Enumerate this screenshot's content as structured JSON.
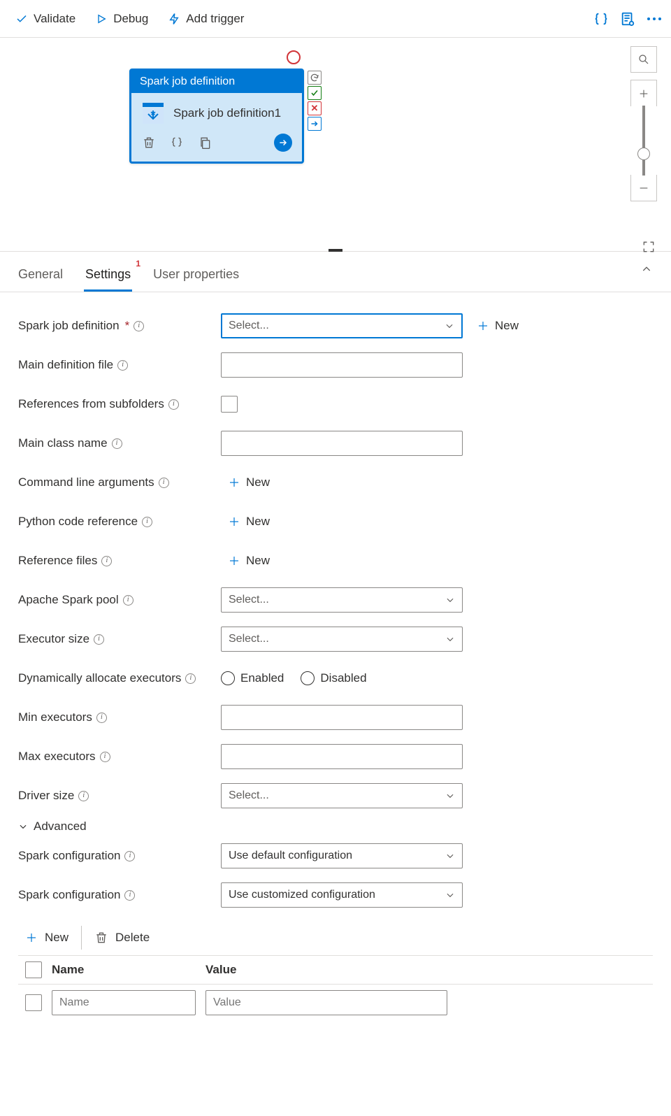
{
  "toolbar": {
    "validate": "Validate",
    "debug": "Debug",
    "add_trigger": "Add trigger"
  },
  "activity": {
    "header": "Spark job definition",
    "title": "Spark job definition1"
  },
  "tabs": {
    "general": "General",
    "settings": "Settings",
    "settings_badge": "1",
    "user_properties": "User properties"
  },
  "form": {
    "spark_job_def": {
      "label": "Spark job definition",
      "placeholder": "Select...",
      "new": "New"
    },
    "main_def_file": {
      "label": "Main definition file"
    },
    "refs_subfolders": {
      "label": "References from subfolders"
    },
    "main_class": {
      "label": "Main class name"
    },
    "cmd_args": {
      "label": "Command line arguments",
      "new": "New"
    },
    "py_ref": {
      "label": "Python code reference",
      "new": "New"
    },
    "ref_files": {
      "label": "Reference files",
      "new": "New"
    },
    "spark_pool": {
      "label": "Apache Spark pool",
      "placeholder": "Select..."
    },
    "exec_size": {
      "label": "Executor size",
      "placeholder": "Select..."
    },
    "dyn_alloc": {
      "label": "Dynamically allocate executors",
      "enabled": "Enabled",
      "disabled": "Disabled"
    },
    "min_exec": {
      "label": "Min executors"
    },
    "max_exec": {
      "label": "Max executors"
    },
    "driver_size": {
      "label": "Driver size",
      "placeholder": "Select..."
    },
    "advanced": "Advanced",
    "spark_conf_default": {
      "label": "Spark configuration",
      "value": "Use default configuration"
    },
    "spark_conf_custom": {
      "label": "Spark configuration",
      "value": "Use customized configuration"
    }
  },
  "cmdbar": {
    "new": "New",
    "delete": "Delete"
  },
  "grid": {
    "head_name": "Name",
    "head_value": "Value",
    "ph_name": "Name",
    "ph_value": "Value"
  }
}
